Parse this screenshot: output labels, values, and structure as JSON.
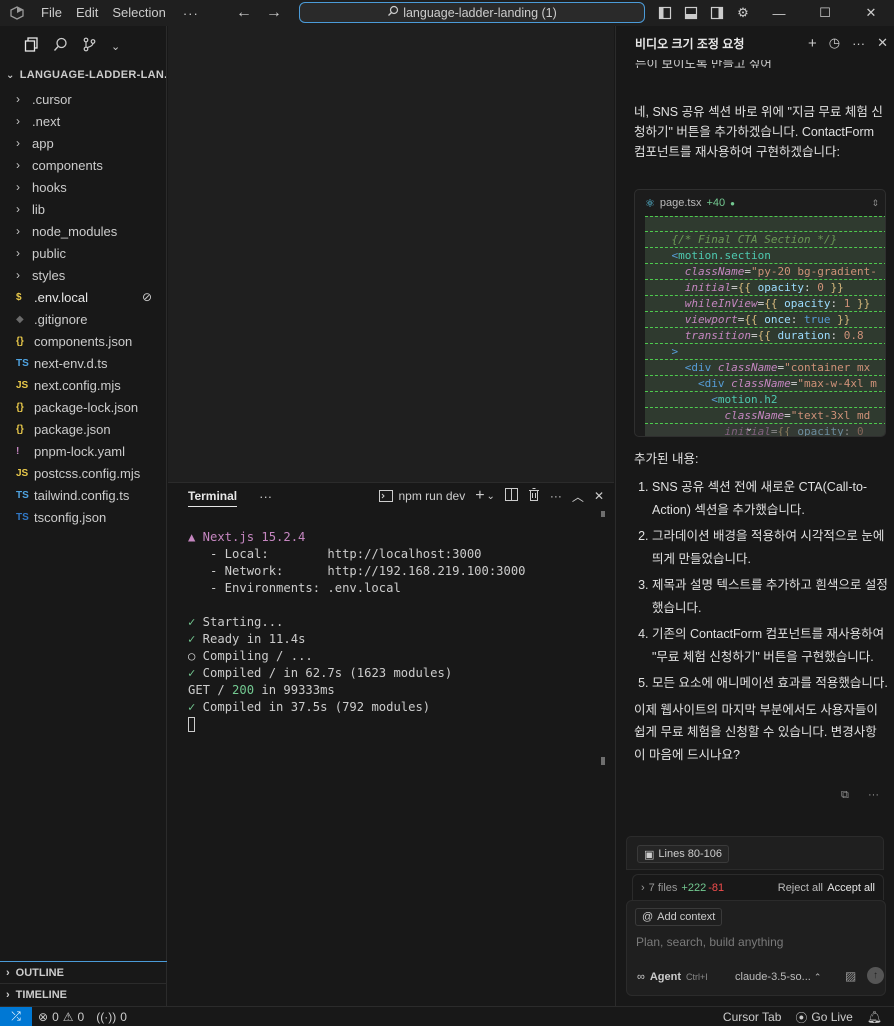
{
  "titlebar": {
    "menu": [
      "File",
      "Edit",
      "Selection"
    ],
    "more": "···",
    "search_text": "language-ladder-landing (1)"
  },
  "sidebar": {
    "explorer_title": "LANGUAGE-LADDER-LAN...",
    "items": [
      {
        "type": "folder",
        "name": ".cursor"
      },
      {
        "type": "folder",
        "name": ".next"
      },
      {
        "type": "folder",
        "name": "app"
      },
      {
        "type": "folder",
        "name": "components"
      },
      {
        "type": "folder",
        "name": "hooks"
      },
      {
        "type": "folder",
        "name": "lib"
      },
      {
        "type": "folder",
        "name": "node_modules"
      },
      {
        "type": "folder",
        "name": "public"
      },
      {
        "type": "folder",
        "name": "styles"
      },
      {
        "type": "file",
        "icon": "$",
        "icon_class": "ic-env",
        "name": ".env.local"
      },
      {
        "type": "file",
        "icon": "◆",
        "icon_class": "ic-git",
        "name": ".gitignore"
      },
      {
        "type": "file",
        "icon": "{}",
        "icon_class": "ic-json",
        "name": "components.json"
      },
      {
        "type": "file",
        "icon": "TS",
        "icon_class": "ic-ts",
        "name": "next-env.d.ts"
      },
      {
        "type": "file",
        "icon": "JS",
        "icon_class": "ic-js",
        "name": "next.config.mjs"
      },
      {
        "type": "file",
        "icon": "{}",
        "icon_class": "ic-json",
        "name": "package-lock.json"
      },
      {
        "type": "file",
        "icon": "{}",
        "icon_class": "ic-json",
        "name": "package.json"
      },
      {
        "type": "file",
        "icon": "!",
        "icon_class": "ic-yaml",
        "name": "pnpm-lock.yaml"
      },
      {
        "type": "file",
        "icon": "JS",
        "icon_class": "ic-js",
        "name": "postcss.config.mjs"
      },
      {
        "type": "file",
        "icon": "TS",
        "icon_class": "ic-ts",
        "name": "tailwind.config.ts"
      },
      {
        "type": "file",
        "icon": "TS",
        "icon_class": "ic-tsconfig",
        "name": "tsconfig.json"
      }
    ],
    "outline_label": "OUTLINE",
    "timeline_label": "TIMELINE"
  },
  "terminal": {
    "tab_label": "Terminal",
    "more": "···",
    "run_label": "npm run dev",
    "lines": {
      "next_version": "▲ Next.js 15.2.4",
      "local": "   - Local:        http://localhost:3000",
      "network": "   - Network:      http://192.168.219.100:3000",
      "env": "   - Environments: .env.local",
      "starting": " Starting...",
      "ready": " Ready in 11.4s",
      "compiling": " Compiling / ...",
      "compiled1": " Compiled / in 62.7s (1623 modules)",
      "get_prefix": "GET / ",
      "get_status": "200",
      "get_suffix": " in 99333ms",
      "compiled2": " Compiled in 37.5s (792 modules)"
    }
  },
  "chat": {
    "title": "비디오 크기 조정 요청",
    "cut_text": "는이 보이도록 만들고 싶어",
    "intro": "네, SNS 공유 섹션 바로 위에 \"지금 무료 체험 신청하기\" 버튼을 추가하겠습니다. ContactForm 컴포넌트를 재사용하여 구현하겠습니다:",
    "code_file": "page.tsx",
    "code_added": "+40",
    "added_heading": "추가된 내용:",
    "list": [
      "SNS 공유 섹션 전에 새로운 CTA(Call-to-Action) 섹션을 추가했습니다.",
      "그라데이션 배경을 적용하여 시각적으로 눈에 띄게 만들었습니다.",
      "제목과 설명 텍스트를 추가하고 흰색으로 설정했습니다.",
      "기존의 ContactForm 컴포넌트를 재사용하여 \"무료 체험 신청하기\" 버튼을 구현했습니다.",
      "모든 요소에 애니메이션 효과를 적용했습니다."
    ],
    "closing": "이제 웹사이트의 마지막 부분에서도 사용자들이 쉽게 무료 체험을 신청할 수 있습니다. 변경사항이 마음에 드시나요?",
    "lines_chip": "Lines 80-106",
    "files_label": "7 files",
    "files_add": "+222",
    "files_del": "-81",
    "reject_all": "Reject all",
    "accept_all": "Accept all",
    "add_context": "Add context",
    "placeholder": "Plan, search, build anything",
    "agent_label": "Agent",
    "agent_shortcut": "Ctrl+I",
    "model": "claude-3.5-so..."
  },
  "statusbar": {
    "errors": "0",
    "warnings": "0",
    "ports": "0",
    "cursor_tab": "Cursor Tab",
    "go_live": "Go Live"
  }
}
